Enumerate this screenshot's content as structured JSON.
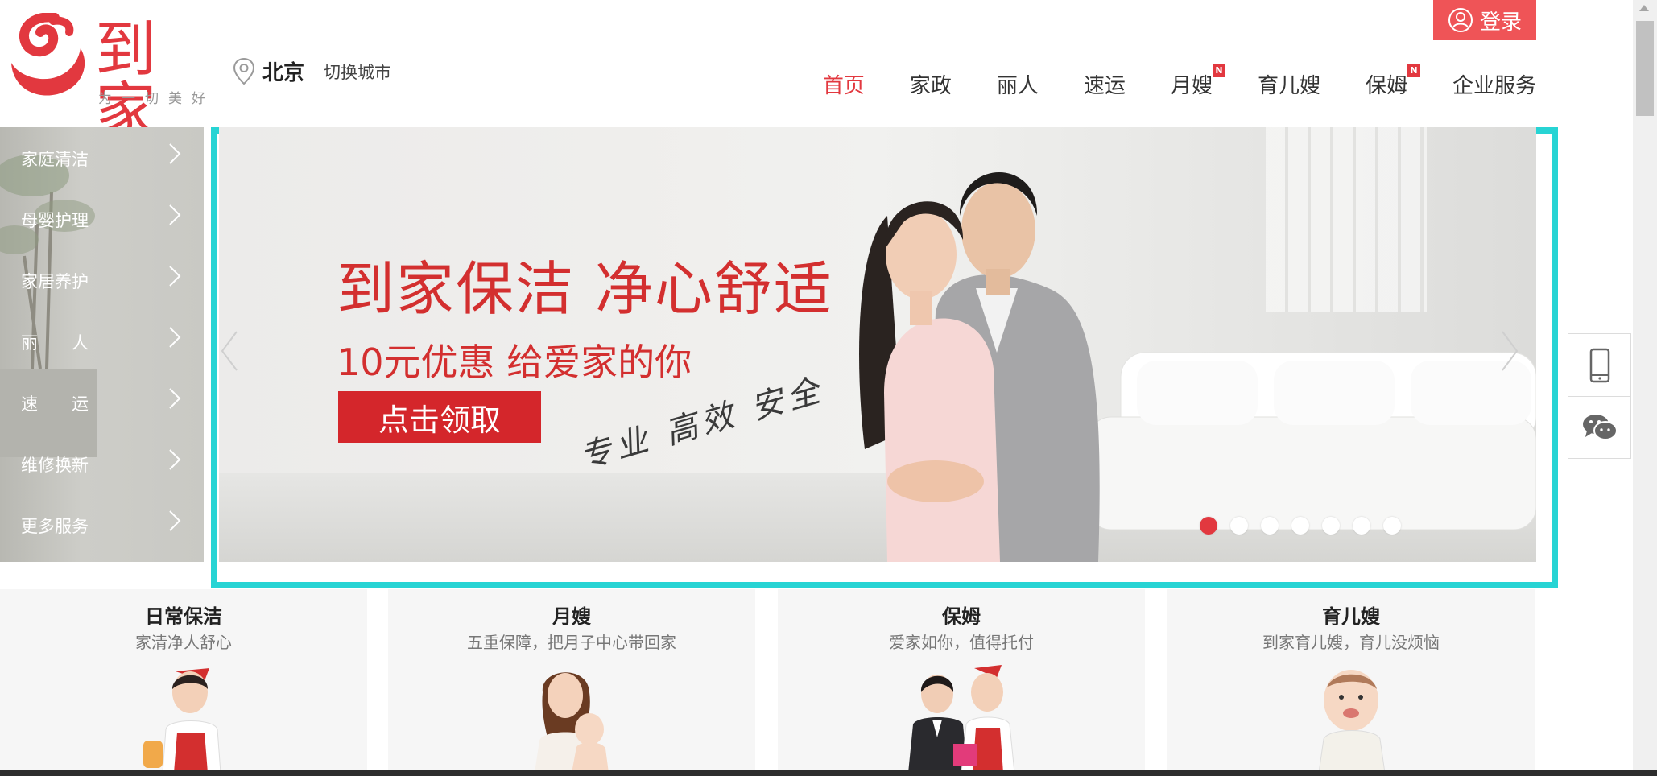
{
  "brand": {
    "name": "到家",
    "slogan": "为一切美好",
    "accent": "#e2383f"
  },
  "city": {
    "name": "北京",
    "switch_label": "切换城市",
    "icon": "location-pin-icon"
  },
  "header": {
    "login_label": "登录",
    "login_icon": "user-circle-icon"
  },
  "nav": {
    "items": [
      {
        "label": "首页",
        "active": true
      },
      {
        "label": "家政"
      },
      {
        "label": "丽人"
      },
      {
        "label": "速运"
      },
      {
        "label": "月嫂",
        "badge": "N"
      },
      {
        "label": "育儿嫂"
      },
      {
        "label": "保姆",
        "badge": "N"
      },
      {
        "label": "企业服务"
      }
    ]
  },
  "sidebar": {
    "items": [
      {
        "label": "家庭清洁"
      },
      {
        "label": "母婴护理"
      },
      {
        "label": "家居养护"
      },
      {
        "label": "丽　　人"
      },
      {
        "label": "速　　运"
      },
      {
        "label": "维修换新"
      },
      {
        "label": "更多服务"
      }
    ]
  },
  "banner": {
    "title": "到家保洁  净心舒适",
    "subtitle": "10元优惠  给爱家的你",
    "cta": "点击领取",
    "script": "专业 高效 安全",
    "dots_total": 7,
    "active_dot": 1,
    "highlight_color": "#27d4d4"
  },
  "float": {
    "items": [
      "mobile-phone-icon",
      "wechat-icon"
    ]
  },
  "services": {
    "cards": [
      {
        "title": "日常保洁",
        "subtitle": "家清净人舒心"
      },
      {
        "title": "月嫂",
        "subtitle": "五重保障，把月子中心带回家"
      },
      {
        "title": "保姆",
        "subtitle": "爱家如你，值得托付"
      },
      {
        "title": "育儿嫂",
        "subtitle": "到家育儿嫂，育儿没烦恼"
      }
    ]
  }
}
